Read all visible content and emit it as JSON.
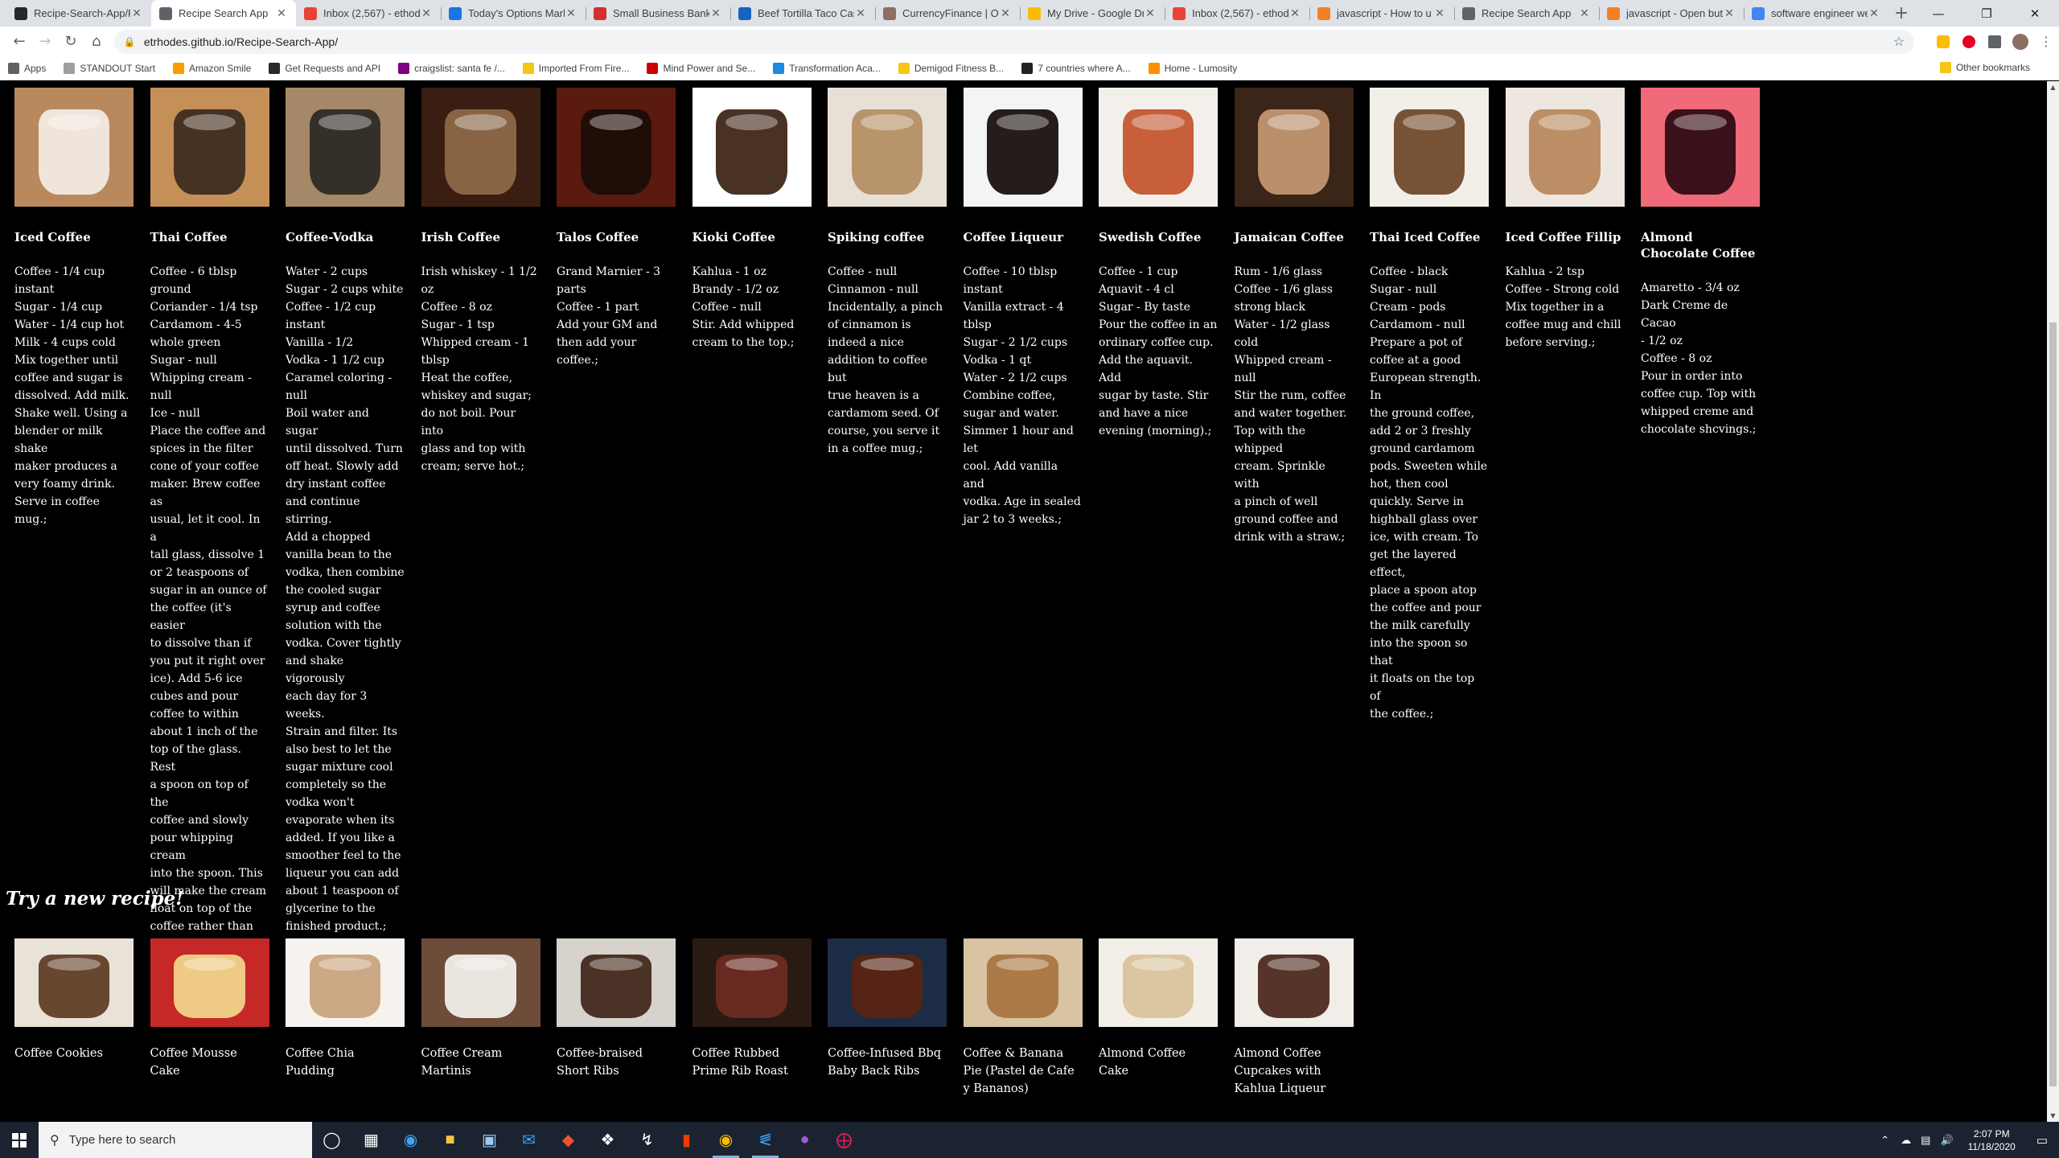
{
  "browser": {
    "tabs": [
      {
        "title": "Recipe-Search-App/R",
        "icon": "github-icon",
        "color": "#24292e"
      },
      {
        "title": "Recipe Search App",
        "icon": "globe-icon",
        "color": "#5f6368",
        "active": true
      },
      {
        "title": "Inbox (2,567) - ethod",
        "icon": "gmail-icon",
        "color": "#ea4335"
      },
      {
        "title": "Today's Options Mark",
        "icon": "chart-icon",
        "color": "#1a73e8"
      },
      {
        "title": "Small Business Bankin",
        "icon": "bank-icon",
        "color": "#d32f2f"
      },
      {
        "title": "Beef Tortilla Taco Cas",
        "icon": "recipe-icon",
        "color": "#1565c0"
      },
      {
        "title": "CurrencyFinance | On",
        "icon": "currency-icon",
        "color": "#8d6e63"
      },
      {
        "title": "My Drive - Google Dr",
        "icon": "drive-icon",
        "color": "#fbbc04"
      },
      {
        "title": "Inbox (2,567) - ethod",
        "icon": "gmail-icon",
        "color": "#ea4335"
      },
      {
        "title": "javascript - How to u",
        "icon": "stackoverflow-icon",
        "color": "#f48024"
      },
      {
        "title": "Recipe Search App",
        "icon": "globe-icon",
        "color": "#5f6368"
      },
      {
        "title": "javascript - Open butt",
        "icon": "stackoverflow-icon",
        "color": "#f48024"
      },
      {
        "title": "software engineer we",
        "icon": "google-icon",
        "color": "#4285f4"
      }
    ],
    "new_tab": "+",
    "url": "etrhodes.github.io/Recipe-Search-App/",
    "bookmarks": [
      {
        "label": "Apps",
        "color": "#5f6368"
      },
      {
        "label": "STANDOUT Start",
        "color": "#9e9e9e"
      },
      {
        "label": "Amazon Smile",
        "color": "#ff9900"
      },
      {
        "label": "Get Requests and API",
        "color": "#24292e"
      },
      {
        "label": "craigslist: santa fe /...",
        "color": "#800080"
      },
      {
        "label": "Imported From Fire...",
        "color": "#f5c518"
      },
      {
        "label": "Mind Power and Se...",
        "color": "#cc0000"
      },
      {
        "label": "Transformation Aca...",
        "color": "#1e88e5"
      },
      {
        "label": "Demigod Fitness B...",
        "color": "#f5c518"
      },
      {
        "label": "7 countries where A...",
        "color": "#222222"
      },
      {
        "label": "Home - Lumosity",
        "color": "#ff8f00"
      }
    ],
    "other_bookmarks": "Other bookmarks"
  },
  "coffee_cards": [
    {
      "title": "Iced Coffee",
      "img": "#b9895d",
      "img2": "#f3ede6",
      "text": "Coffee - 1/4 cup\ninstant\nSugar - 1/4 cup\nWater - 1/4 cup hot\nMilk - 4 cups cold\nMix together until\ncoffee and sugar is\ndissolved. Add milk.\nShake well. Using a\nblender or milk shake\nmaker produces a\nvery foamy drink.\nServe in coffee mug.;"
    },
    {
      "title": "Thai Coffee",
      "img": "#c58f58",
      "img2": "#3b2a1e",
      "text": "Coffee - 6 tblsp\nground\nCoriander - 1/4 tsp\nCardamom - 4-5\nwhole green\nSugar - null\nWhipping cream -\nnull\nIce - null\nPlace the coffee and\nspices in the filter\ncone of your coffee\nmaker. Brew coffee as\nusual, let it cool. In a\ntall glass, dissolve 1\nor 2 teaspoons of\nsugar in an ounce of\nthe coffee (it's easier\nto dissolve than if\nyou put it right over\nice). Add 5-6 ice\ncubes and pour\ncoffee to within\nabout 1 inch of the\ntop of the glass. Rest\na spoon on top of the\ncoffee and slowly\npour whipping cream\ninto the spoon. This\nwill make the cream\nfloat on top of the\ncoffee rather than\ndispersing into it\nright away.;"
    },
    {
      "title": "Coffee-Vodka",
      "img": "#a58867",
      "img2": "#2b2724",
      "text": "Water - 2 cups\nSugar - 2 cups white\nCoffee - 1/2 cup\ninstant\nVanilla - 1/2\nVodka - 1 1/2 cup\nCaramel coloring -\nnull\nBoil water and sugar\nuntil dissolved. Turn\noff heat. Slowly add\ndry instant coffee\nand continue stirring.\nAdd a chopped\nvanilla bean to the\nvodka, then combine\nthe cooled sugar\nsyrup and coffee\nsolution with the\nvodka. Cover tightly\nand shake vigorously\neach day for 3 weeks.\nStrain and filter. Its\nalso best to let the\nsugar mixture cool\ncompletely so the\nvodka won't\nevaporate when its\nadded. If you like a\nsmoother feel to the\nliqueur you can add\nabout 1 teaspoon of\nglycerine to the\nfinished product.;"
    },
    {
      "title": "Irish Coffee",
      "img": "#3a1e12",
      "img2": "#8f6a4a",
      "text": "Irish whiskey - 1 1/2\noz\nCoffee - 8 oz\nSugar - 1 tsp\nWhipped cream - 1\ntblsp\nHeat the coffee,\nwhiskey and sugar;\ndo not boil. Pour into\nglass and top with\ncream; serve hot.;"
    },
    {
      "title": "Talos Coffee",
      "img": "#5a1a10",
      "img2": "#1a0d08",
      "text": "Grand Marnier - 3\nparts\nCoffee - 1 part\nAdd your GM and\nthen add your\ncoffee.;"
    },
    {
      "title": "Kioki Coffee",
      "img": "#ffffff",
      "img2": "#3a2010",
      "text": "Kahlua - 1 oz\nBrandy - 1/2 oz\nCoffee - null\nStir. Add whipped\ncream to the top.;"
    },
    {
      "title": "Spiking coffee",
      "img": "#e8e0d6",
      "img2": "#b38d62",
      "text": "Coffee - null\nCinnamon - null\nIncidentally, a pinch\nof cinnamon is\nindeed a nice\naddition to coffee but\ntrue heaven is a\ncardamom seed. Of\ncourse, you serve it\nin a coffee mug.;"
    },
    {
      "title": "Coffee Liqueur",
      "img": "#f4f4f4",
      "img2": "#120a06",
      "text": "Coffee - 10 tblsp\ninstant\nVanilla extract - 4\ntblsp\nSugar - 2 1/2 cups\nVodka - 1 qt\nWater - 2 1/2 cups\nCombine coffee,\nsugar and water.\nSimmer 1 hour and let\ncool. Add vanilla and\nvodka. Age in sealed\njar 2 to 3 weeks.;"
    },
    {
      "title": "Swedish Coffee",
      "img": "#f3f0ec",
      "img2": "#c2532a",
      "text": "Coffee - 1 cup\nAquavit - 4 cl\nSugar - By taste\nPour the coffee in an\nordinary coffee cup.\nAdd the aquavit. Add\nsugar by taste. Stir\nand have a nice\nevening (morning).;"
    },
    {
      "title": "Jamaican Coffee",
      "img": "#3b2418",
      "img2": "#c59a74",
      "text": "Rum - 1/6 glass\nCoffee - 1/6 glass\nstrong black\nWater - 1/2 glass\ncold\nWhipped cream -\nnull\nStir the rum, coffee\nand water together.\nTop with the whipped\ncream. Sprinkle with\na pinch of well\nground coffee and\ndrink with a straw.;"
    },
    {
      "title": "Thai Iced Coffee",
      "img": "#f2efe9",
      "img2": "#6e4424",
      "text": "Coffee - black\nSugar - null\nCream - pods\nCardamom - null\nPrepare a pot of\ncoffee at a good\nEuropean strength. In\nthe ground coffee,\nadd 2 or 3 freshly\nground cardamom\npods. Sweeten while\nhot, then cool\nquickly. Serve in\nhighball glass over\nice, with cream. To\nget the layered effect,\nplace a spoon atop\nthe coffee and pour\nthe milk carefully\ninto the spoon so that\nit floats on the top of\nthe coffee.;"
    },
    {
      "title": "Iced Coffee Fillip",
      "img": "#ede7e0",
      "img2": "#b7875a",
      "text": "Kahlua - 2 tsp\nCoffee - Strong cold\nMix together in a\ncoffee mug and chill\nbefore serving.;"
    },
    {
      "title": "Almond Chocolate Coffee",
      "img": "#f06a7a",
      "img2": "#2a0a12",
      "text": "Amaretto - 3/4 oz\nDark Creme de Cacao\n- 1/2 oz\nCoffee - 8 oz\nPour in order into\ncoffee cup. Top with\nwhipped creme and\nchocolate shcvings.;"
    }
  ],
  "try_new": {
    "heading": "Try a new recipe!",
    "recipes": [
      {
        "title": "Coffee Cookies",
        "img": "#5b3a22",
        "img2": "#e9e2d6"
      },
      {
        "title": "Coffee Mousse Cake",
        "img": "#f2d88c",
        "img2": "#c62828"
      },
      {
        "title": "Coffee Chia Pudding",
        "img": "#c9a27b",
        "img2": "#f6f3ef"
      },
      {
        "title": "Coffee Cream Martinis",
        "img": "#f5f2ee",
        "img2": "#6d4c3a"
      },
      {
        "title": "Coffee-braised Short Ribs",
        "img": "#3e2418",
        "img2": "#d7d2cc"
      },
      {
        "title": "Coffee Rubbed Prime Rib Roast",
        "img": "#6e2b22",
        "img2": "#2a1a14"
      },
      {
        "title": "Coffee-Infused Bbq Baby Back Ribs",
        "img": "#5a2410",
        "img2": "#1c2c44"
      },
      {
        "title": "Coffee & Banana Pie (Pastel de Cafe y Bananos)",
        "img": "#a7743f",
        "img2": "#d8c3a3"
      },
      {
        "title": "Almond Coffee Cake",
        "img": "#d9c29a",
        "img2": "#f3efe8"
      },
      {
        "title": "Almond Coffee Cupcakes with Kahlua Liqueur",
        "img": "#4a2418",
        "img2": "#f1ede8"
      }
    ]
  },
  "taskbar": {
    "search_placeholder": "Type here to search",
    "time": "2:07 PM",
    "date": "11/18/2020"
  }
}
